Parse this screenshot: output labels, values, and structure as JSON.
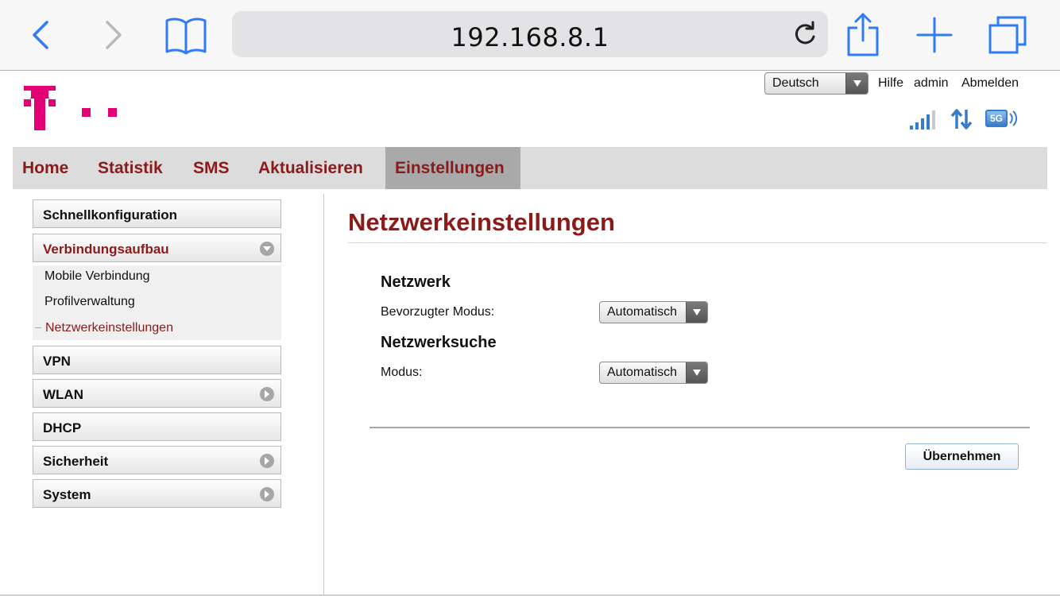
{
  "browser": {
    "address": "192.168.8.1",
    "accent": "#2f7cf6"
  },
  "header": {
    "language": "Deutsch",
    "links": {
      "help": "Hilfe",
      "user": "admin",
      "logout": "Abmelden"
    },
    "brand_color": "#e20074",
    "status_badge": "5G"
  },
  "nav": {
    "items": [
      {
        "label": "Home"
      },
      {
        "label": "Statistik"
      },
      {
        "label": "SMS"
      },
      {
        "label": "Aktualisieren"
      },
      {
        "label": "Einstellungen",
        "active": true
      }
    ]
  },
  "sidebar": {
    "items": [
      {
        "label": "Schnellkonfiguration"
      },
      {
        "label": "Verbindungsaufbau",
        "expanded": true
      },
      {
        "label": "VPN"
      },
      {
        "label": "WLAN"
      },
      {
        "label": "DHCP"
      },
      {
        "label": "Sicherheit"
      },
      {
        "label": "System"
      }
    ],
    "subitems": [
      {
        "label": "Mobile Verbindung"
      },
      {
        "label": "Profilverwaltung"
      },
      {
        "label": "Netzwerkeinstellungen",
        "active": true
      }
    ]
  },
  "main": {
    "title": "Netzwerkeinstellungen",
    "network": {
      "heading": "Netzwerk",
      "mode_label": "Bevorzugter Modus:",
      "mode_value": "Automatisch"
    },
    "search": {
      "heading": "Netzwerksuche",
      "mode_label": "Modus:",
      "mode_value": "Automatisch"
    },
    "apply_label": "Übernehmen"
  },
  "colors": {
    "accent_red": "#8b1a1a",
    "nav_bg": "#dcdcdc",
    "nav_active": "#a9a9a9"
  }
}
